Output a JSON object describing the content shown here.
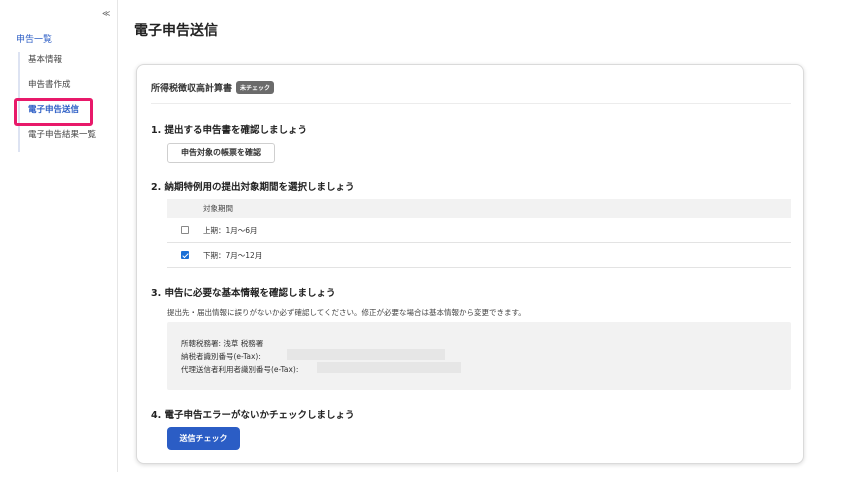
{
  "sidebar": {
    "collapse_icon_glyph": "≪",
    "parent_label": "申告一覧",
    "items": [
      {
        "label": "基本情報"
      },
      {
        "label": "申告書作成"
      },
      {
        "label": "電子申告送信"
      },
      {
        "label": "電子申告結果一覧"
      }
    ],
    "active_item": "電子申告送信",
    "highlight_color": "#e8196a"
  },
  "page": {
    "title": "電子申告送信"
  },
  "card": {
    "doc_name": "所得税徴収高計算書",
    "badge": "未チェック"
  },
  "steps": {
    "s1": {
      "title": "1. 提出する申告書を確認しましょう",
      "button": "申告対象の帳票を確認"
    },
    "s2": {
      "title": "2. 納期特例用の提出対象期間を選択しましょう",
      "column_header": "対象期間",
      "rows": [
        {
          "label": "上期：1月〜6月",
          "checked": false
        },
        {
          "label": "下期：7月〜12月",
          "checked": true
        }
      ]
    },
    "s3": {
      "title": "3. 申告に必要な基本情報を確認しましょう",
      "description": "提出先・届出情報に誤りがないか必ず確認してください。修正が必要な場合は基本情報から変更できます。",
      "tax_office": "所轄税務署: 浅草 税務署",
      "taxpayer_id_label": "納税者識別番号(e-Tax):",
      "agent_id_label": "代理送信者利用者識別番号(e-Tax):"
    },
    "s4": {
      "title": "4. 電子申告エラーがないかチェックしましょう",
      "button": "送信チェック"
    }
  },
  "colors": {
    "accent": "#2b5dc5",
    "checkbox": "#1a6fd6"
  }
}
